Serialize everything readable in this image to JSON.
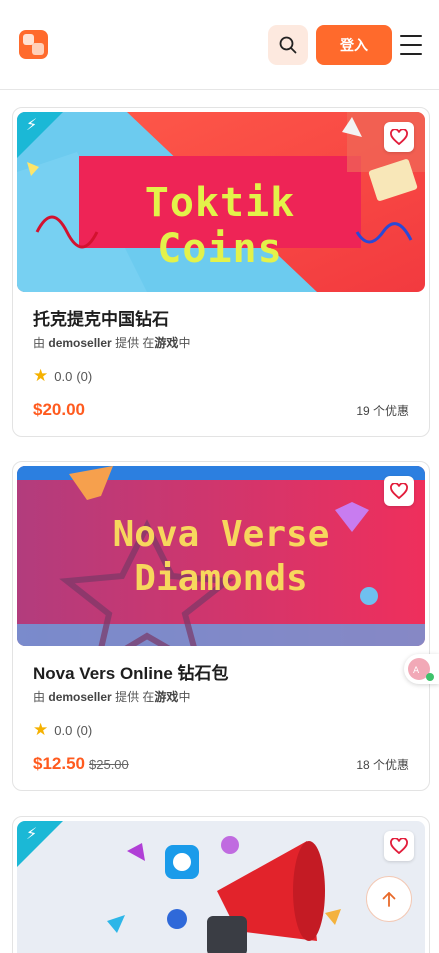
{
  "header": {
    "logo_icon": "logo-icon",
    "search_icon": "search-icon",
    "login_label": "登入",
    "menu_icon": "hamburger-menu-icon"
  },
  "products": [
    {
      "banner_text": "Toktik Coins",
      "title": "托克提克中国钻石",
      "seller_prefix": "由",
      "seller": "demoseller",
      "seller_mid": "提供 在",
      "seller_place": "游戏",
      "seller_suffix": "中",
      "rating": "0.0",
      "rating_count": "(0)",
      "price": "$20.00",
      "old_price": "",
      "offers": "19 个优惠"
    },
    {
      "banner_line1": "Nova Verse",
      "banner_line2": "Diamonds",
      "title": "Nova Vers Online 钻石包",
      "seller_prefix": "由",
      "seller": "demoseller",
      "seller_mid": "提供 在",
      "seller_place": "游戏",
      "seller_suffix": "中",
      "rating": "0.0",
      "rating_count": "(0)",
      "price": "$12.50",
      "old_price": "$25.00",
      "offers": "18 个优惠"
    }
  ],
  "floating": {
    "scroll_top_icon": "arrow-up-icon",
    "translate_icon": "translate-icon"
  },
  "colors": {
    "accent": "#ff6a2c",
    "price": "#ff5b1f",
    "corner_badge": "#1bb8d6",
    "star": "#f5b100"
  }
}
